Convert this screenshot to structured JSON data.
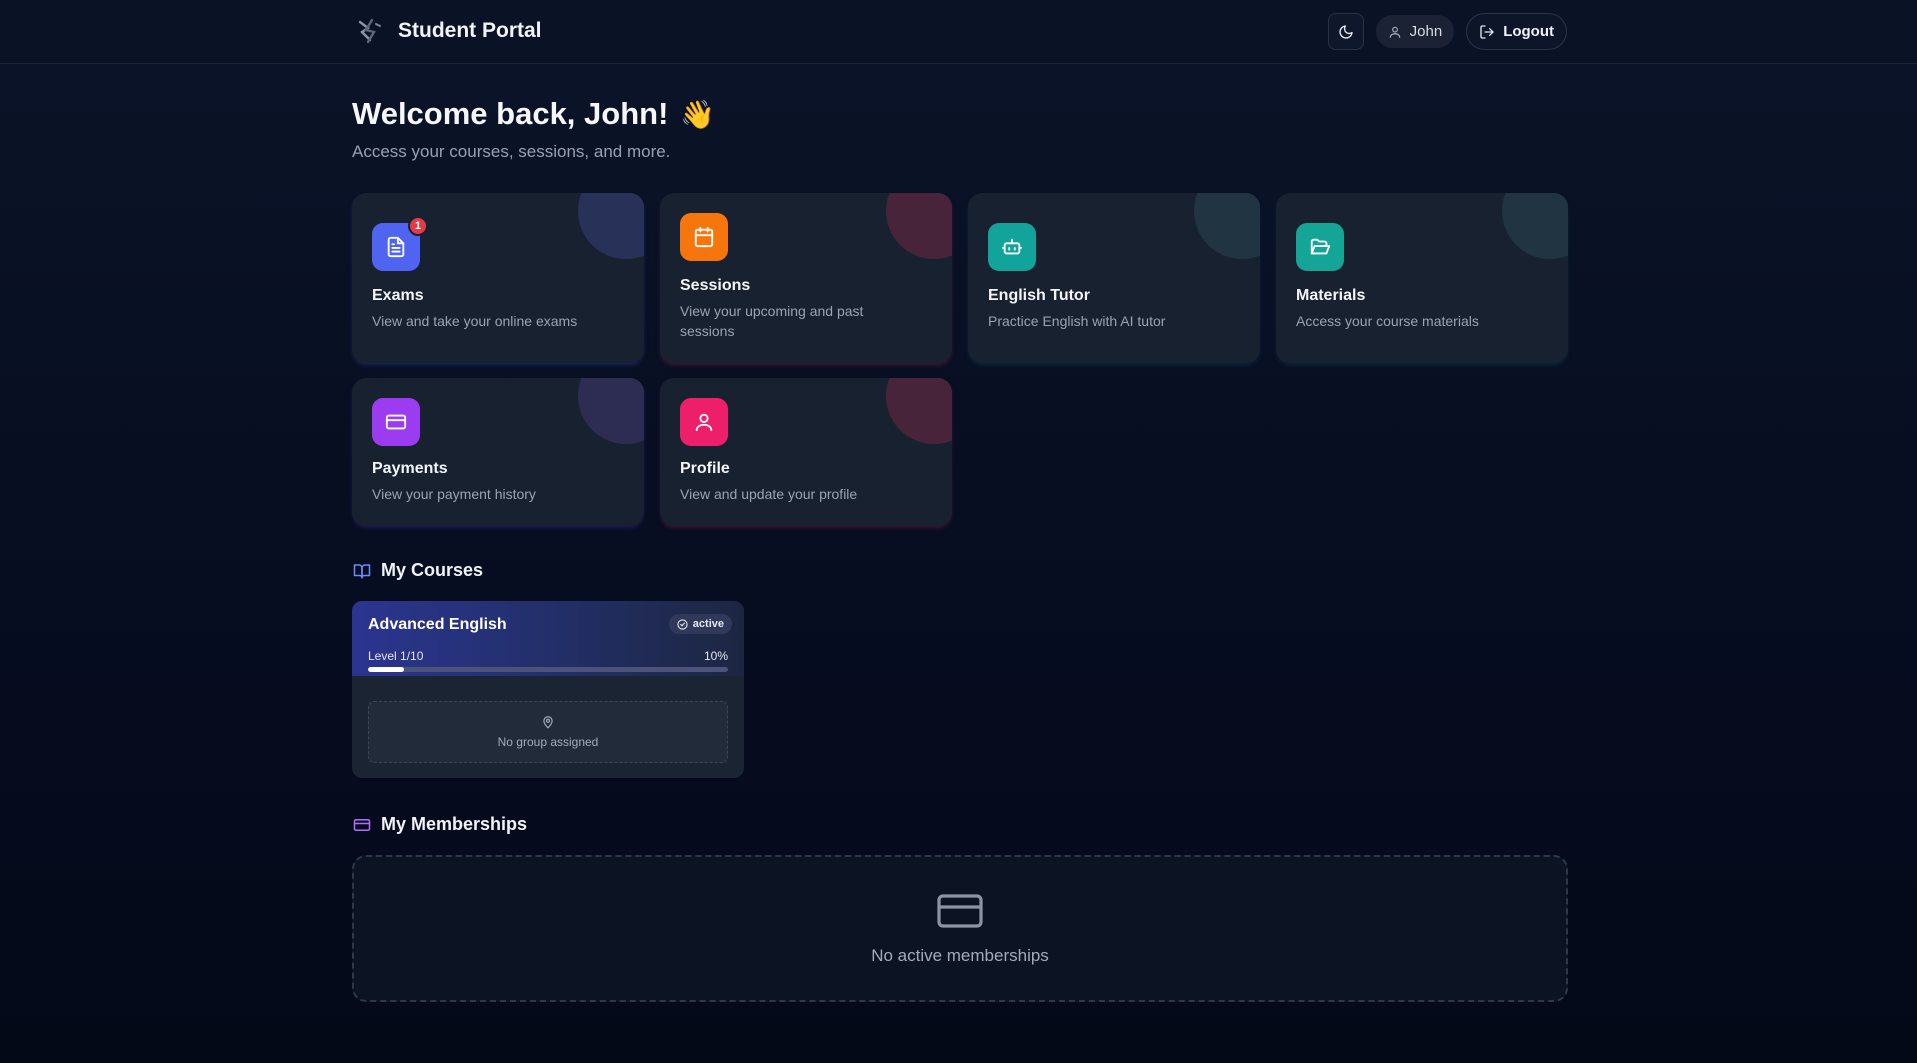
{
  "header": {
    "brand_title": "Student Portal",
    "theme_toggle_icon": "moon-icon",
    "user_name": "John",
    "logout_label": "Logout"
  },
  "welcome": {
    "title": "Welcome back, John!",
    "emoji": "👋",
    "subtitle": "Access your courses, sessions, and more."
  },
  "cards": [
    {
      "title": "Exams",
      "desc": "View and take your online exams",
      "icon": "document-icon",
      "color": "#4f64f0",
      "badge": "1"
    },
    {
      "title": "Sessions",
      "desc": "View your upcoming and past sessions",
      "icon": "calendar-icon",
      "color": "#f6760d"
    },
    {
      "title": "English Tutor",
      "desc": "Practice English with AI tutor",
      "icon": "bot-icon",
      "color": "#12a39a"
    },
    {
      "title": "Materials",
      "desc": "Access your course materials",
      "icon": "folder-icon",
      "color": "#14a596"
    },
    {
      "title": "Payments",
      "desc": "View your payment history",
      "icon": "credit-card-icon",
      "color": "#9b3cf0"
    },
    {
      "title": "Profile",
      "desc": "View and update your profile",
      "icon": "user-icon",
      "color": "#ee1f6a"
    }
  ],
  "courses_section": {
    "title": "My Courses",
    "icon": "book-icon",
    "items": [
      {
        "name": "Advanced English",
        "status": "active",
        "level": "Level 1/10",
        "progress_label": "10%",
        "progress": 0.1,
        "group": "No group assigned"
      }
    ]
  },
  "memberships_section": {
    "title": "My Memberships",
    "icon": "credit-card-icon",
    "empty_text": "No active memberships"
  }
}
